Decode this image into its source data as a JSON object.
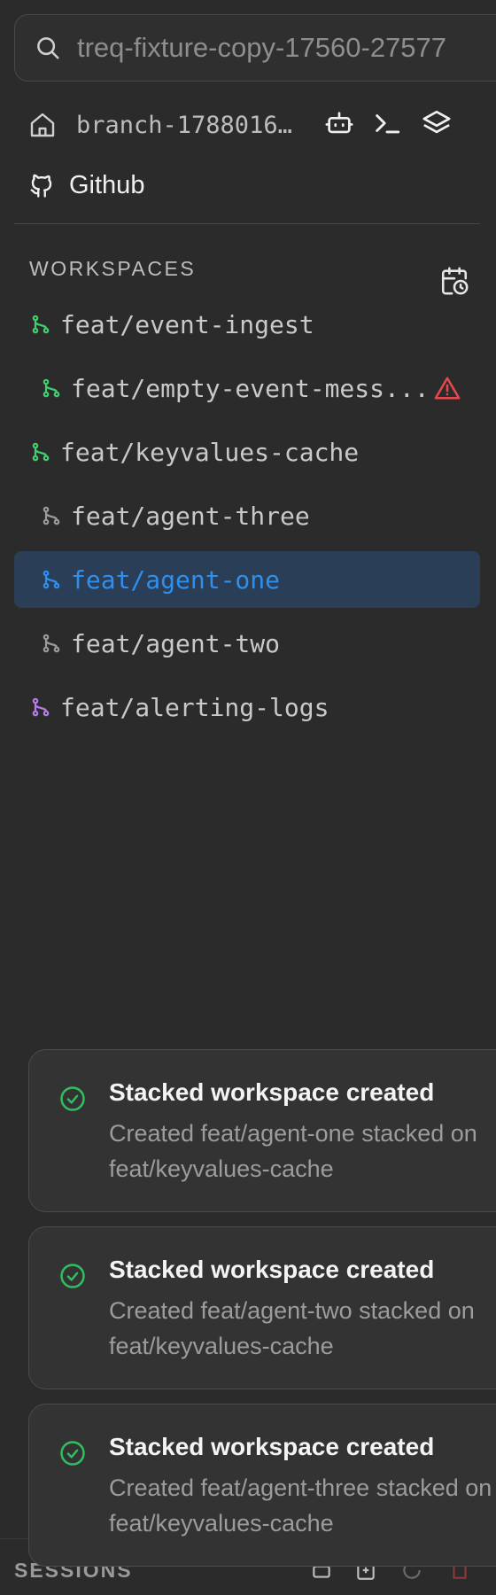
{
  "search": {
    "value": "treq-fixture-copy-17560-27577"
  },
  "branch": {
    "name": "branch-1788016..."
  },
  "github": {
    "label": "Github"
  },
  "workspaces": {
    "title": "WORKSPACES",
    "items": [
      {
        "label": "feat/event-ingest",
        "color": "#3fcf6e"
      },
      {
        "label": "feat/empty-event-mess...",
        "color": "#3fcf6e",
        "warning": true
      },
      {
        "label": "feat/keyvalues-cache",
        "color": "#3fcf6e"
      },
      {
        "label": "feat/agent-three",
        "color": "#9a9a9a"
      },
      {
        "label": "feat/agent-one",
        "color": "#2f8fef",
        "selected": true
      },
      {
        "label": "feat/agent-two",
        "color": "#9a9a9a"
      },
      {
        "label": "feat/alerting-logs",
        "color": "#b57be8"
      }
    ]
  },
  "toasts": [
    {
      "title": "Stacked workspace created",
      "line1": "Created feat/agent-one stacked on",
      "line2": "feat/keyvalues-cache"
    },
    {
      "title": "Stacked workspace created",
      "line1": "Created feat/agent-two stacked on",
      "line2": "feat/keyvalues-cache"
    },
    {
      "title": "Stacked workspace created",
      "line1": "Created feat/agent-three stacked on",
      "line2": "feat/keyvalues-cache"
    }
  ],
  "sessions": {
    "label": "SESSIONS"
  },
  "colors": {
    "success": "#2fbf5f",
    "warning": "#e5484d",
    "accent": "#2f8fef",
    "selected_bg": "#2a3e57"
  }
}
